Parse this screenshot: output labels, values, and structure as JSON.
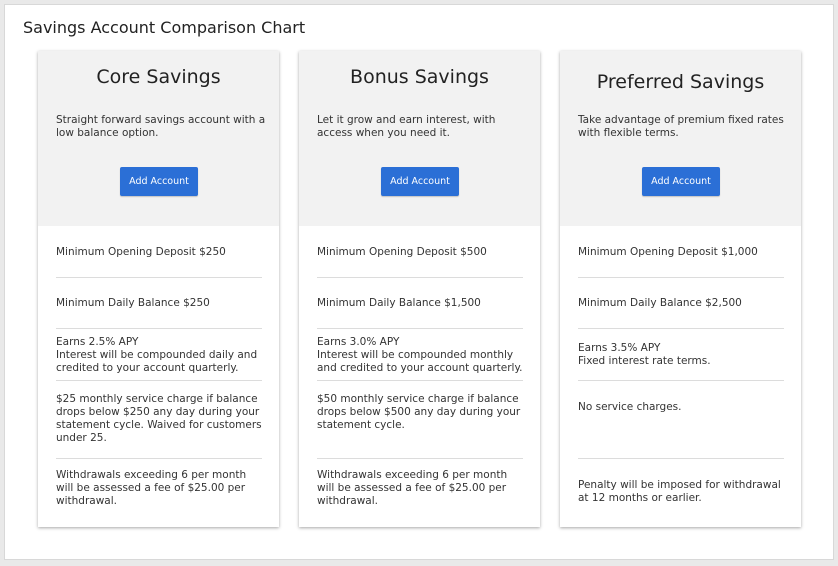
{
  "page": {
    "title": "Savings Account Comparison Chart",
    "accent_color": "#2b6fd6"
  },
  "cards": [
    {
      "title": "Core Savings",
      "description": "Straight forward savings account with a low balance option.",
      "button_label": "Add Account",
      "features": [
        "Minimum Opening Deposit $250",
        "Minimum Daily Balance $250",
        "Earns 2.5% APY\nInterest will be compounded daily and credited to your account quarterly.",
        "$25 monthly service charge if balance drops below $250 any day during your statement cycle. Waived for customers under 25.",
        "Withdrawals exceeding 6 per month will be assessed a fee of $25.00 per withdrawal."
      ]
    },
    {
      "title": "Bonus Savings",
      "description": "Let it grow and earn interest, with access when you need it.",
      "button_label": "Add Account",
      "features": [
        "Minimum Opening Deposit $500",
        "Minimum Daily Balance $1,500",
        "Earns 3.0% APY\nInterest will be compounded monthly and credited to your account quarterly.",
        "$50 monthly service charge if balance drops below $500 any day during your statement cycle.",
        "Withdrawals exceeding 6 per month will be assessed a fee of $25.00 per withdrawal."
      ]
    },
    {
      "title": "Preferred Savings",
      "description": "Take advantage of premium fixed rates with flexible terms.",
      "button_label": "Add Account",
      "features": [
        "Minimum Opening Deposit $1,000",
        "Minimum Daily Balance $2,500",
        "Earns 3.5% APY\nFixed interest rate terms.",
        "No service charges.",
        "Penalty will be imposed for withdrawal at 12 months or earlier."
      ]
    }
  ]
}
